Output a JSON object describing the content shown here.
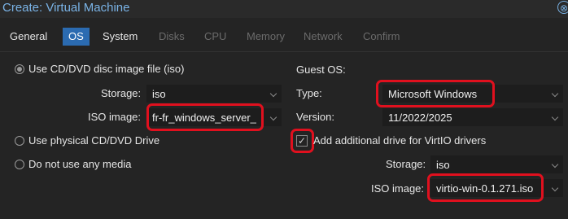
{
  "window": {
    "title": "Create: Virtual Machine",
    "close_glyph": "⊗"
  },
  "tabs": [
    {
      "label": "General",
      "state": "normal"
    },
    {
      "label": "OS",
      "state": "active"
    },
    {
      "label": "System",
      "state": "normal"
    },
    {
      "label": "Disks",
      "state": "disabled"
    },
    {
      "label": "CPU",
      "state": "disabled"
    },
    {
      "label": "Memory",
      "state": "disabled"
    },
    {
      "label": "Network",
      "state": "disabled"
    },
    {
      "label": "Confirm",
      "state": "disabled"
    }
  ],
  "left": {
    "use_iso_label": "Use CD/DVD disc image file (iso)",
    "storage_label": "Storage:",
    "storage_value": "iso",
    "iso_label": "ISO image:",
    "iso_value": "fr-fr_windows_server_",
    "physical_label": "Use physical CD/DVD Drive",
    "no_media_label": "Do not use any media"
  },
  "right": {
    "guest_os_label": "Guest OS:",
    "type_label": "Type:",
    "type_value": "Microsoft Windows",
    "version_label": "Version:",
    "version_value": "11/2022/2025",
    "virtio_label": "Add additional drive for VirtIO drivers",
    "virtio_checked_glyph": "✓",
    "storage_label": "Storage:",
    "storage_value": "iso",
    "iso_label": "ISO image:",
    "iso_value": "virtio-win-0.1.271.iso"
  },
  "colors": {
    "accent": "#2b6bb1",
    "title": "#7ab3e6",
    "highlight": "#e0101e",
    "background": "#242424"
  },
  "icons": {
    "close": "close-icon",
    "dropdown": "chevron-down-icon"
  }
}
